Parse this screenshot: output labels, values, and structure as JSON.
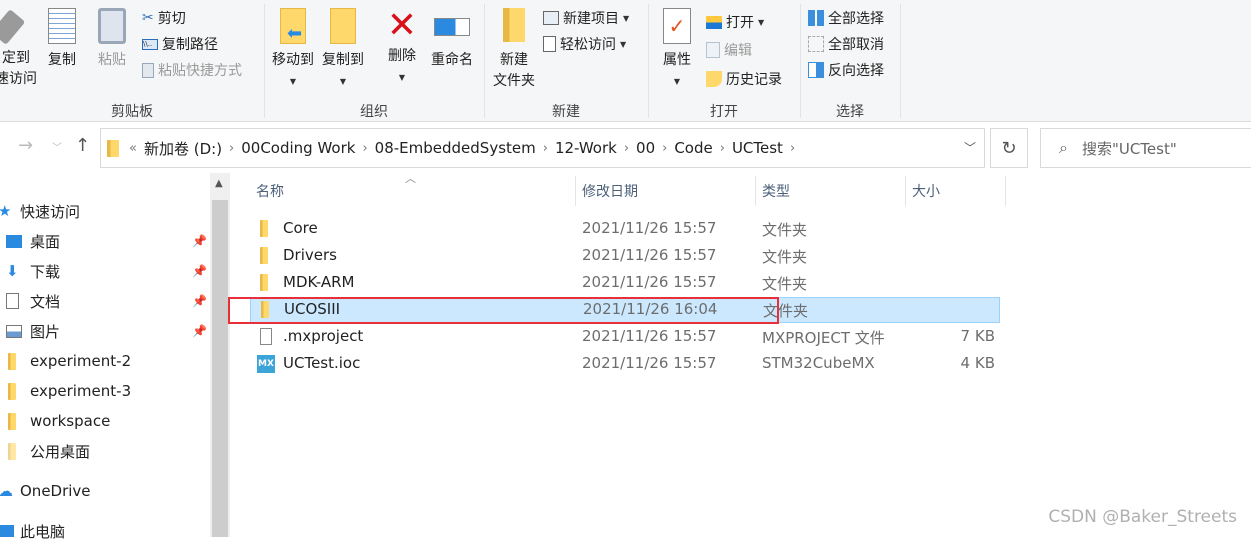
{
  "ribbon": {
    "clipboard": {
      "label": "剪贴板",
      "pin": "固定到快速访问",
      "pin_l1": "定到",
      "pin_l2": "速访问",
      "copy": "复制",
      "paste": "粘贴",
      "cut": "剪切",
      "copy_path": "复制路径",
      "paste_shortcut": "粘贴快捷方式"
    },
    "organize": {
      "label": "组织",
      "move_to": "移动到",
      "copy_to": "复制到",
      "delete": "删除",
      "rename": "重命名"
    },
    "new": {
      "label": "新建",
      "new_folder_l1": "新建",
      "new_folder_l2": "文件夹",
      "new_item": "新建项目",
      "easy_access": "轻松访问"
    },
    "open": {
      "label": "打开",
      "properties": "属性",
      "open": "打开",
      "edit": "编辑",
      "history": "历史记录"
    },
    "select": {
      "label": "选择",
      "select_all": "全部选择",
      "select_none": "全部取消",
      "invert": "反向选择"
    }
  },
  "address": {
    "overflow": "«",
    "crumbs": [
      "新加卷 (D:)",
      "00Coding Work",
      "08-EmbeddedSystem",
      "12-Work",
      "00",
      "Code",
      "UCTest"
    ]
  },
  "search": {
    "placeholder": "搜索\"UCTest\""
  },
  "nav": {
    "items": [
      {
        "label": "快速访问"
      },
      {
        "label": "桌面"
      },
      {
        "label": "下载"
      },
      {
        "label": "文档"
      },
      {
        "label": "图片"
      },
      {
        "label": "experiment-2"
      },
      {
        "label": "experiment-3"
      },
      {
        "label": "workspace"
      },
      {
        "label": "公用桌面"
      },
      {
        "label": "OneDrive"
      },
      {
        "label": "此电脑"
      }
    ]
  },
  "columns": {
    "name": "名称",
    "date": "修改日期",
    "type": "类型",
    "size": "大小"
  },
  "files": [
    {
      "name": "Core",
      "date": "2021/11/26 15:57",
      "type": "文件夹",
      "size": ""
    },
    {
      "name": "Drivers",
      "date": "2021/11/26 15:57",
      "type": "文件夹",
      "size": ""
    },
    {
      "name": "MDK-ARM",
      "date": "2021/11/26 15:57",
      "type": "文件夹",
      "size": ""
    },
    {
      "name": "UCOSIII",
      "date": "2021/11/26 16:04",
      "type": "文件夹",
      "size": "",
      "selected": true
    },
    {
      "name": ".mxproject",
      "date": "2021/11/26 15:57",
      "type": "MXPROJECT 文件",
      "size": "7 KB"
    },
    {
      "name": "UCTest.ioc",
      "date": "2021/11/26 15:57",
      "type": "STM32CubeMX",
      "size": "4 KB"
    }
  ],
  "mx_icon_text": "MX",
  "watermark": "CSDN @Baker_Streets",
  "colors": {
    "selection": "#cce8ff",
    "highlight_box": "#e8303a",
    "folder": "#ffd86b"
  }
}
